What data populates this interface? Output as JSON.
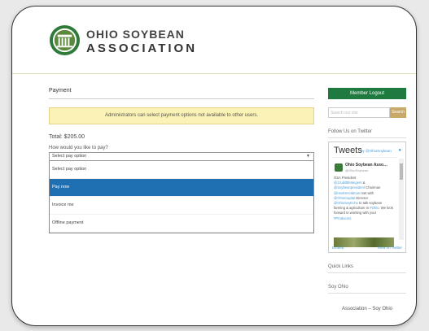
{
  "header": {
    "brand_line1": "OHIO SOYBEAN",
    "brand_line2": "ASSOCIATION"
  },
  "main": {
    "title": "Payment",
    "notice": "Administrators can select payment options not available to other users.",
    "total": "Total: $205.00",
    "question": "How would you like to pay?",
    "select_value": "Select pay option",
    "options": [
      "Select pay option",
      "Pay now",
      "Invoice me",
      "Offline payment"
    ]
  },
  "sidebar": {
    "logout_label": "Member Logout",
    "search_placeholder": "Search our site",
    "search_button": "Search",
    "follow_heading": "Follow Us on Twitter",
    "tweets_title": "Tweets",
    "tweets_by": "by @OhioSoybean",
    "tweet": {
      "name": "Ohio Soybean Asso…",
      "handle": "@OhioSoybean",
      "text_plain": "OSA President",
      "link1": "@JJuddBMangers",
      "text_and": " &",
      "link2": "@Soybeanpresident",
      "text_chairman": " Chairman",
      "link3": "@HarrisHoldman",
      "text_met": " met with",
      "link4": "@OhioCapital",
      "text_director": " Director",
      "link5": "@OhioSoyEcho",
      "text_rest": " to talk soybean farming & agriculture in",
      "link6": "#Ohio",
      "text_end": ". We look forward to working with your",
      "link7": "#Producers"
    },
    "embed_label": "Embed",
    "view_label": "View on Twitter",
    "quick_links": "Quick Links",
    "soy_ohio": "Soy Ohio",
    "assoc_label": "Association – Soy Ohio"
  },
  "colors": {
    "logout_green": "#1e7a3e",
    "selected_blue": "#1f6fb3",
    "notice_yellow": "#fbf2b6",
    "search_tan": "#c9a96a"
  }
}
